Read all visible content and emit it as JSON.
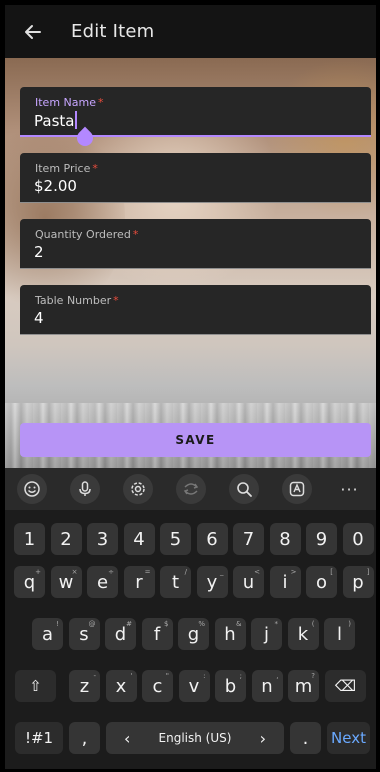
{
  "appbar": {
    "title": "Edit Item",
    "back_icon": "arrow-left-icon"
  },
  "fields": [
    {
      "label": "Item Name",
      "required": "*",
      "value": "Pasta",
      "active": true
    },
    {
      "label": "Item Price",
      "required": "*",
      "value": "$2.00"
    },
    {
      "label": "Quantity Ordered",
      "required": "*",
      "value": "2"
    },
    {
      "label": "Table Number",
      "required": "*",
      "value": "4"
    }
  ],
  "save_label": "SAVE",
  "keyboard": {
    "toolbar": [
      "emoji-icon",
      "mic-icon",
      "settings-icon",
      "translate-icon",
      "search-icon",
      "text-extract-icon",
      "more-icon"
    ],
    "more_label": "···",
    "row_numbers": [
      "1",
      "2",
      "3",
      "4",
      "5",
      "6",
      "7",
      "8",
      "9",
      "0"
    ],
    "row1": [
      "q",
      "w",
      "e",
      "r",
      "t",
      "y",
      "u",
      "i",
      "o",
      "p"
    ],
    "row1_hints": [
      "+",
      "×",
      "÷",
      "=",
      "/",
      "_",
      "<",
      ">",
      "[",
      "]"
    ],
    "row2": [
      "a",
      "s",
      "d",
      "f",
      "g",
      "h",
      "j",
      "k",
      "l"
    ],
    "row2_hints": [
      "!",
      "@",
      "#",
      "$",
      "%",
      "&",
      "*",
      "(",
      ")"
    ],
    "row3": [
      "z",
      "x",
      "c",
      "v",
      "b",
      "n",
      "m"
    ],
    "row3_hints": [
      "-",
      "'",
      "\"",
      ":",
      ";",
      ",",
      "?"
    ],
    "shift_label": "⇧",
    "backspace_label": "⌫",
    "symbols_label": "!#1",
    "comma_label": ",",
    "space_label": "English (US)",
    "left_arrow": "‹",
    "right_arrow": "›",
    "period_label": ".",
    "next_label": "Next"
  }
}
